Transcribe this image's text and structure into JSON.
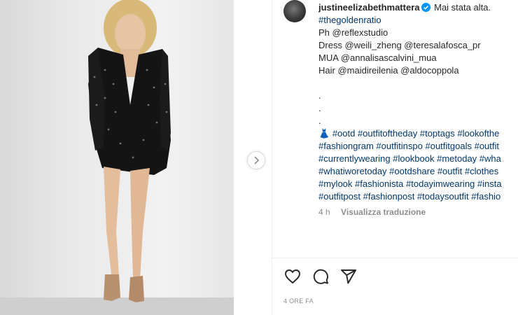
{
  "post": {
    "username": "justineelizabethmattera",
    "caption_first": "Mai stata alta.",
    "caption_lines": [
      "#thegoldenratio",
      "Ph @reflexstudio",
      "Dress @weili_zheng @teresalafosca_pr",
      "MUA @annalisascalvini_mua",
      "Hair @maidireilenia @aldocoppola"
    ],
    "dots": [
      ".",
      ".",
      "."
    ],
    "hashtag_emoji": "👗",
    "hashtag_lines": [
      "#ootd #outfitoftheday #toptags #lookofthe",
      "#fashiongram #outfitinspo #outfitgoals #outfit",
      "#currentlywearing #lookbook #metoday #wha",
      "#whatiworetoday #ootdshare #outfit #clothes",
      "#mylook #fashionista #todayimwearing #insta",
      "#outfitpost #fashionpost #todaysoutfit #fashio"
    ],
    "time_ago": "4 h",
    "translate_label": "Visualizza traduzione",
    "timestamp": "4 ORE FA"
  },
  "icons": {
    "like": "heart-icon",
    "comment": "comment-icon",
    "share": "share-icon",
    "next": "chevron-right-icon",
    "verified": "verified-badge-icon"
  },
  "colors": {
    "text": "#262626",
    "hashtag": "#00376b",
    "muted": "#8e8e8e",
    "verified": "#0095f6"
  }
}
